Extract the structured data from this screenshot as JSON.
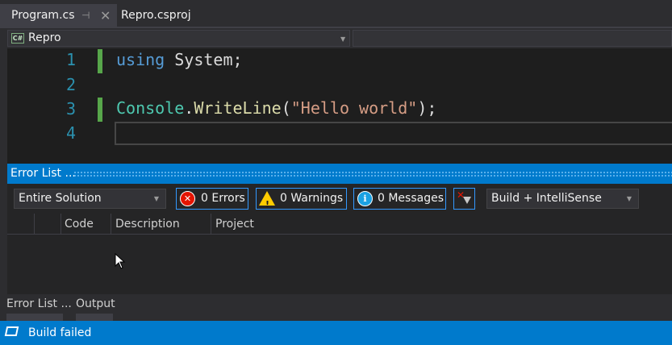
{
  "tabs": [
    {
      "label": "Program.cs",
      "active": true
    },
    {
      "label": "Repro.csproj",
      "active": false
    }
  ],
  "tab_pin_glyph": "⊣",
  "tab_close_glyph": "✕",
  "nav": {
    "project": "Repro",
    "project_icon_text": "C#"
  },
  "editor": {
    "line_numbers": [
      "1",
      "2",
      "3",
      "4"
    ],
    "line1": {
      "keyword": "using",
      "rest": " System;"
    },
    "line3": {
      "type": "Console",
      "dot": ".",
      "method": "WriteLine",
      "open": "(",
      "string": "\"Hello world\"",
      "close": ");"
    }
  },
  "error_list": {
    "title": "Error List ...",
    "scope": "Entire Solution",
    "errors_label": "0 Errors",
    "warnings_label": "0 Warnings",
    "messages_label": "0 Messages",
    "source": "Build + IntelliSense",
    "columns": [
      "Code",
      "Description",
      "Project"
    ]
  },
  "bottom_tabs": [
    "Error List ...",
    "Output"
  ],
  "status": {
    "text": "Build failed"
  },
  "colors": {
    "accent": "#007acc",
    "error": "#e51400",
    "warning": "#ffcc00",
    "info": "#1ba1e2",
    "keyword": "#569cd6",
    "type": "#4ec9b0",
    "string": "#d69d85",
    "line_number": "#2b91af"
  }
}
